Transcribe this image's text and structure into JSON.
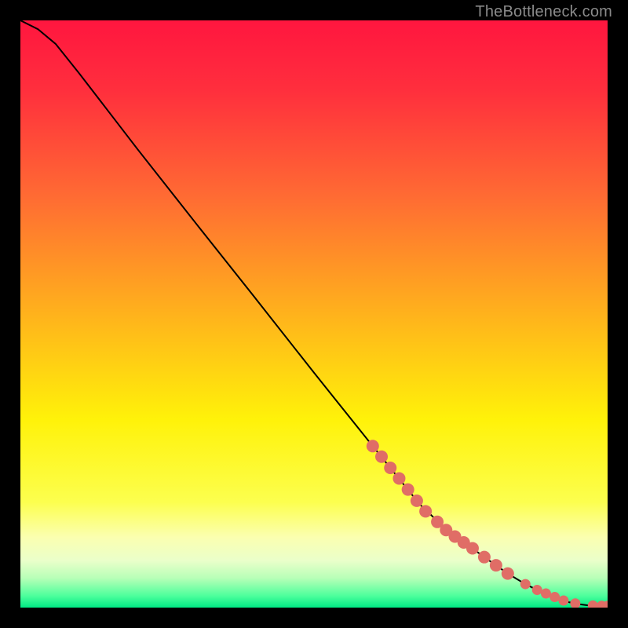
{
  "attribution": "TheBottleneck.com",
  "chart_data": {
    "type": "line",
    "title": "",
    "xlabel": "",
    "ylabel": "",
    "xlim": [
      0,
      100
    ],
    "ylim": [
      0,
      100
    ],
    "grid": false,
    "legend": false,
    "background": {
      "gradient_stops": [
        {
          "pct": 0,
          "color": "#ff163f"
        },
        {
          "pct": 12,
          "color": "#ff2f3d"
        },
        {
          "pct": 30,
          "color": "#ff6b33"
        },
        {
          "pct": 50,
          "color": "#ffb21c"
        },
        {
          "pct": 68,
          "color": "#fff209"
        },
        {
          "pct": 82,
          "color": "#fcff4e"
        },
        {
          "pct": 88,
          "color": "#fbffb0"
        },
        {
          "pct": 92,
          "color": "#eaffca"
        },
        {
          "pct": 95,
          "color": "#b7ffb7"
        },
        {
          "pct": 98,
          "color": "#4dff9c"
        },
        {
          "pct": 100,
          "color": "#00e984"
        }
      ]
    },
    "series": [
      {
        "name": "curve",
        "color": "#000000",
        "x": [
          0,
          3,
          6,
          10,
          15,
          20,
          30,
          40,
          50,
          60,
          68,
          72,
          76,
          79,
          82,
          84,
          86,
          88,
          90,
          92,
          93.5,
          95,
          96.5,
          98,
          100
        ],
        "y": [
          100,
          98.5,
          96,
          91,
          84.5,
          78,
          65.3,
          52.7,
          40,
          27.5,
          17.6,
          13.8,
          10.8,
          8.6,
          6.5,
          5.2,
          4.0,
          3.0,
          2.2,
          1.4,
          0.9,
          0.6,
          0.4,
          0.3,
          0.3
        ]
      }
    ],
    "markers": {
      "name": "highlighted-points",
      "color": "#e06d66",
      "radius_large": 8,
      "radius_small": 6.5,
      "points": [
        {
          "x": 60.0,
          "y": 27.5,
          "r": "large"
        },
        {
          "x": 61.5,
          "y": 25.7,
          "r": "large"
        },
        {
          "x": 63.0,
          "y": 23.8,
          "r": "large"
        },
        {
          "x": 64.5,
          "y": 22.0,
          "r": "large"
        },
        {
          "x": 66.0,
          "y": 20.1,
          "r": "large"
        },
        {
          "x": 67.5,
          "y": 18.2,
          "r": "large"
        },
        {
          "x": 69.0,
          "y": 16.4,
          "r": "large"
        },
        {
          "x": 71.0,
          "y": 14.6,
          "r": "large"
        },
        {
          "x": 72.5,
          "y": 13.2,
          "r": "large"
        },
        {
          "x": 74.0,
          "y": 12.1,
          "r": "large"
        },
        {
          "x": 75.5,
          "y": 11.1,
          "r": "large"
        },
        {
          "x": 77.0,
          "y": 10.1,
          "r": "large"
        },
        {
          "x": 79.0,
          "y": 8.6,
          "r": "large"
        },
        {
          "x": 81.0,
          "y": 7.2,
          "r": "large"
        },
        {
          "x": 83.0,
          "y": 5.8,
          "r": "large"
        },
        {
          "x": 86.0,
          "y": 4.0,
          "r": "small"
        },
        {
          "x": 88.0,
          "y": 3.0,
          "r": "small"
        },
        {
          "x": 89.5,
          "y": 2.4,
          "r": "small"
        },
        {
          "x": 91.0,
          "y": 1.8,
          "r": "small"
        },
        {
          "x": 92.5,
          "y": 1.2,
          "r": "small"
        },
        {
          "x": 94.5,
          "y": 0.7,
          "r": "small"
        },
        {
          "x": 97.5,
          "y": 0.35,
          "r": "small"
        },
        {
          "x": 99.0,
          "y": 0.3,
          "r": "small"
        },
        {
          "x": 100.0,
          "y": 0.3,
          "r": "small"
        }
      ]
    }
  }
}
